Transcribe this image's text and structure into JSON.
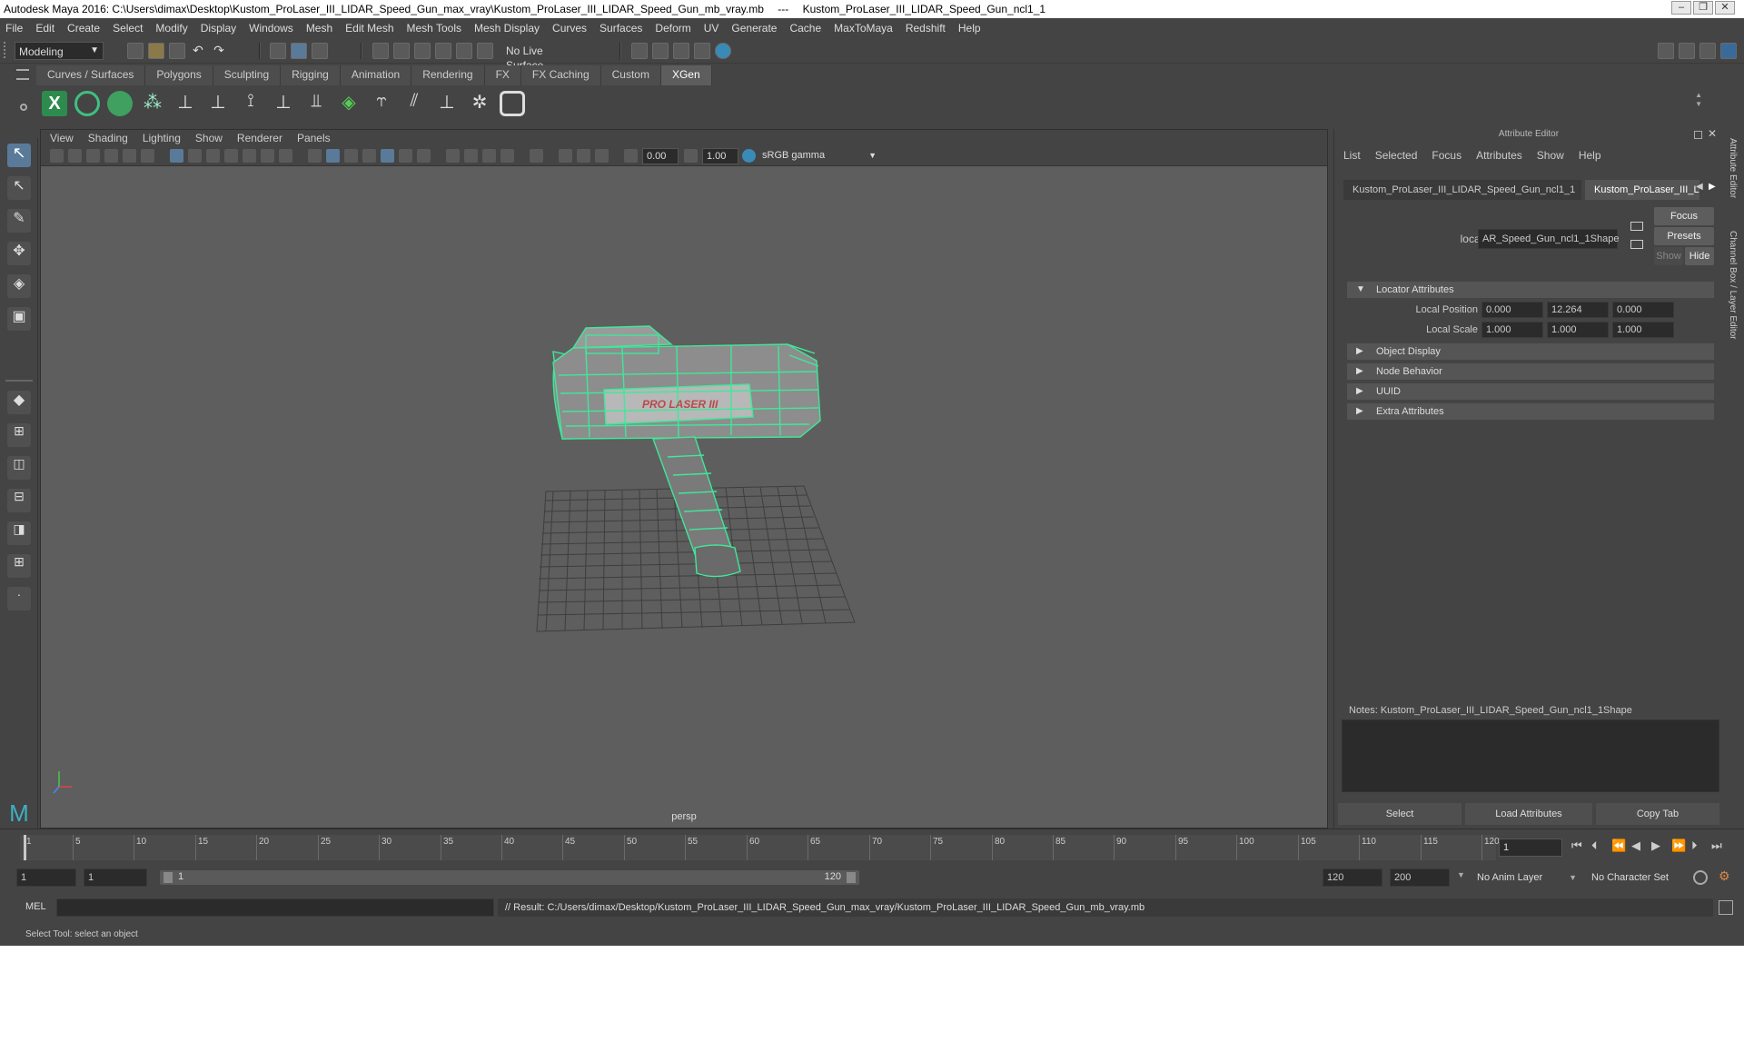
{
  "window": {
    "title": "Autodesk Maya 2016: C:\\Users\\dimax\\Desktop\\Kustom_ProLaser_III_LIDAR_Speed_Gun_max_vray\\Kustom_ProLaser_III_LIDAR_Speed_Gun_mb_vray.mb",
    "separator": "---",
    "object": "Kustom_ProLaser_III_LIDAR_Speed_Gun_ncl1_1"
  },
  "menubar": [
    "File",
    "Edit",
    "Create",
    "Select",
    "Modify",
    "Display",
    "Windows",
    "Mesh",
    "Edit Mesh",
    "Mesh Tools",
    "Mesh Display",
    "Curves",
    "Surfaces",
    "Deform",
    "UV",
    "Generate",
    "Cache",
    "MaxToMaya",
    "Redshift",
    "Help"
  ],
  "statusline": {
    "mode": "Modeling",
    "live_surface": "No Live Surface"
  },
  "shelf_tabs": [
    "Curves / Surfaces",
    "Polygons",
    "Sculpting",
    "Rigging",
    "Animation",
    "Rendering",
    "FX",
    "FX Caching",
    "Custom",
    "XGen"
  ],
  "shelf_active": "XGen",
  "viewport": {
    "menu": [
      "View",
      "Shading",
      "Lighting",
      "Show",
      "Renderer",
      "Panels"
    ],
    "exposure": "0.00",
    "gamma": "1.00",
    "color_space": "sRGB gamma",
    "camera": "persp",
    "model_label": "PRO LASER III"
  },
  "attribute_editor": {
    "title": "Attribute Editor",
    "menu": [
      "List",
      "Selected",
      "Focus",
      "Attributes",
      "Show",
      "Help"
    ],
    "tabs": [
      "Kustom_ProLaser_III_LIDAR_Speed_Gun_ncl1_1",
      "Kustom_ProLaser_III_LI"
    ],
    "locator_label": "locator:",
    "locator_value": "AR_Speed_Gun_ncl1_1Shape",
    "buttons": {
      "focus": "Focus",
      "presets": "Presets",
      "show": "Show",
      "hide": "Hide"
    },
    "sections": [
      "Locator Attributes",
      "Object Display",
      "Node Behavior",
      "UUID",
      "Extra Attributes"
    ],
    "local_position": {
      "label": "Local Position",
      "x": "0.000",
      "y": "12.264",
      "z": "0.000"
    },
    "local_scale": {
      "label": "Local Scale",
      "x": "1.000",
      "y": "1.000",
      "z": "1.000"
    },
    "notes_label": "Notes:  Kustom_ProLaser_III_LIDAR_Speed_Gun_ncl1_1Shape",
    "bottom_buttons": [
      "Select",
      "Load Attributes",
      "Copy Tab"
    ]
  },
  "side_tabs": [
    "Attribute Editor",
    "Channel Box / Layer Editor"
  ],
  "timeline": {
    "ticks": [
      "1",
      "5",
      "10",
      "15",
      "20",
      "25",
      "30",
      "35",
      "40",
      "45",
      "50",
      "55",
      "60",
      "65",
      "70",
      "75",
      "80",
      "85",
      "90",
      "95",
      "100",
      "105",
      "110",
      "115",
      "120"
    ],
    "current_frame": "1"
  },
  "range": {
    "start": "1",
    "playback_start": "1",
    "slider_start": "1",
    "slider_end": "120",
    "playback_end": "120",
    "end": "200",
    "anim_layer": "No Anim Layer",
    "character_set": "No Character Set"
  },
  "command": {
    "lang": "MEL",
    "result": "// Result: C:/Users/dimax/Desktop/Kustom_ProLaser_III_LIDAR_Speed_Gun_max_vray/Kustom_ProLaser_III_LIDAR_Speed_Gun_mb_vray.mb"
  },
  "help_line": "Select Tool: select an object",
  "colors": {
    "wireframe": "#3fe89a",
    "accent_tab": "#5d5d5d",
    "viewport_bg": "#5e5e5e"
  }
}
